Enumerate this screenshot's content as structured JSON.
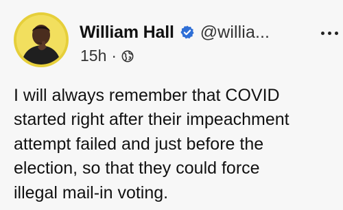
{
  "author": {
    "name": "William Hall",
    "handle": "@willia...",
    "avatar_icon": "profile-photo-avatar",
    "verified_icon": "verified-badge-icon",
    "verified_color": "#2f6fd6"
  },
  "meta": {
    "time": "15h",
    "separator": "·",
    "audience_icon": "globe-icon"
  },
  "post": {
    "lines": [
      "I will always remember that COVID",
      "started right after their impeachment",
      "attempt failed and just before the",
      "election, so that they could force",
      "illegal mail-in voting."
    ]
  },
  "menu_icon": "more-options-icon"
}
